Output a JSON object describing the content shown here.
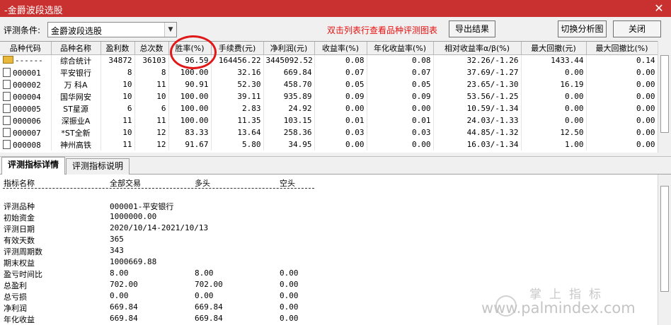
{
  "window": {
    "title": "-金爵波段选股",
    "close_symbol": "✕"
  },
  "toolbar": {
    "condition_label": "评测条件:",
    "condition_value": "金爵波段选股",
    "hint": "双击列表行查看品种评测图表",
    "export_label": "导出结果",
    "switch_label": "切换分析图",
    "close_label": "关闭"
  },
  "table": {
    "columns": [
      "品种代码",
      "品种名称",
      "盈利数",
      "总次数",
      "胜率(%)",
      "手续费(元)",
      "净利润(元)",
      "收益率(%)",
      "年化收益率(%)",
      "相对收益率α/β(%)",
      "最大回撤(元)",
      "最大回撤比(%)"
    ],
    "rows": [
      [
        "------",
        "综合统计",
        "34872",
        "36103",
        "96.59",
        "164456.22",
        "3445092.52",
        "0.08",
        "0.08",
        "32.26/-1.26",
        "1433.44",
        "0.14"
      ],
      [
        "000001",
        "平安银行",
        "8",
        "8",
        "100.00",
        "32.16",
        "669.84",
        "0.07",
        "0.07",
        "37.69/-1.27",
        "0.00",
        "0.00"
      ],
      [
        "000002",
        "万 科A",
        "10",
        "11",
        "90.91",
        "52.30",
        "458.70",
        "0.05",
        "0.05",
        "23.65/-1.30",
        "16.19",
        "0.00"
      ],
      [
        "000004",
        "国华网安",
        "10",
        "10",
        "100.00",
        "39.11",
        "935.89",
        "0.09",
        "0.09",
        "53.56/-1.25",
        "0.00",
        "0.00"
      ],
      [
        "000005",
        "ST星源",
        "6",
        "6",
        "100.00",
        "2.83",
        "24.92",
        "0.00",
        "0.00",
        "10.59/-1.34",
        "0.00",
        "0.00"
      ],
      [
        "000006",
        "深振业A",
        "11",
        "11",
        "100.00",
        "11.35",
        "103.15",
        "0.01",
        "0.01",
        "24.03/-1.33",
        "0.00",
        "0.00"
      ],
      [
        "000007",
        "*ST全新",
        "10",
        "12",
        "83.33",
        "13.64",
        "258.36",
        "0.03",
        "0.03",
        "44.85/-1.32",
        "12.50",
        "0.00"
      ],
      [
        "000008",
        "神州高铁",
        "11",
        "12",
        "91.67",
        "5.80",
        "34.95",
        "0.00",
        "0.00",
        "16.03/-1.34",
        "1.00",
        "0.00"
      ]
    ]
  },
  "tabs": [
    {
      "label": "评测指标详情",
      "active": true
    },
    {
      "label": "评测指标说明",
      "active": false
    }
  ],
  "detail": {
    "header": [
      "指标名称",
      "全部交易",
      "多头",
      "空头"
    ],
    "rows": [
      [
        "评测品种",
        "000001-平安银行",
        "",
        ""
      ],
      [
        "初始资金",
        "1000000.00",
        "",
        ""
      ],
      [
        "评测日期",
        "2020/10/14-2021/10/13",
        "",
        ""
      ],
      [
        "有效天数",
        "365",
        "",
        ""
      ],
      [
        "评测周期数",
        "343",
        "",
        ""
      ],
      [
        "期末权益",
        "1000669.88",
        "",
        ""
      ],
      [
        "盈亏时间比",
        "8.00",
        "8.00",
        "0.00"
      ],
      [
        "总盈利",
        "702.00",
        "702.00",
        "0.00"
      ],
      [
        "总亏损",
        "0.00",
        "0.00",
        "0.00"
      ],
      [
        "净利润",
        "669.84",
        "669.84",
        "0.00"
      ],
      [
        "年化收益",
        "669.84",
        "669.84",
        "0.00"
      ]
    ]
  },
  "watermark": {
    "cn": "掌上指标",
    "url": "www.palmindex.com"
  }
}
